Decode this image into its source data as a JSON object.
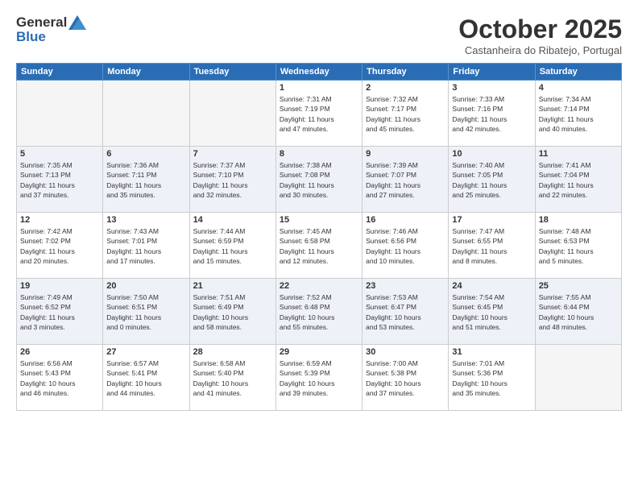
{
  "header": {
    "logo_general": "General",
    "logo_blue": "Blue",
    "month": "October 2025",
    "location": "Castanheira do Ribatejo, Portugal"
  },
  "weekdays": [
    "Sunday",
    "Monday",
    "Tuesday",
    "Wednesday",
    "Thursday",
    "Friday",
    "Saturday"
  ],
  "weeks": [
    [
      {
        "day": "",
        "info": ""
      },
      {
        "day": "",
        "info": ""
      },
      {
        "day": "",
        "info": ""
      },
      {
        "day": "1",
        "info": "Sunrise: 7:31 AM\nSunset: 7:19 PM\nDaylight: 11 hours\nand 47 minutes."
      },
      {
        "day": "2",
        "info": "Sunrise: 7:32 AM\nSunset: 7:17 PM\nDaylight: 11 hours\nand 45 minutes."
      },
      {
        "day": "3",
        "info": "Sunrise: 7:33 AM\nSunset: 7:16 PM\nDaylight: 11 hours\nand 42 minutes."
      },
      {
        "day": "4",
        "info": "Sunrise: 7:34 AM\nSunset: 7:14 PM\nDaylight: 11 hours\nand 40 minutes."
      }
    ],
    [
      {
        "day": "5",
        "info": "Sunrise: 7:35 AM\nSunset: 7:13 PM\nDaylight: 11 hours\nand 37 minutes."
      },
      {
        "day": "6",
        "info": "Sunrise: 7:36 AM\nSunset: 7:11 PM\nDaylight: 11 hours\nand 35 minutes."
      },
      {
        "day": "7",
        "info": "Sunrise: 7:37 AM\nSunset: 7:10 PM\nDaylight: 11 hours\nand 32 minutes."
      },
      {
        "day": "8",
        "info": "Sunrise: 7:38 AM\nSunset: 7:08 PM\nDaylight: 11 hours\nand 30 minutes."
      },
      {
        "day": "9",
        "info": "Sunrise: 7:39 AM\nSunset: 7:07 PM\nDaylight: 11 hours\nand 27 minutes."
      },
      {
        "day": "10",
        "info": "Sunrise: 7:40 AM\nSunset: 7:05 PM\nDaylight: 11 hours\nand 25 minutes."
      },
      {
        "day": "11",
        "info": "Sunrise: 7:41 AM\nSunset: 7:04 PM\nDaylight: 11 hours\nand 22 minutes."
      }
    ],
    [
      {
        "day": "12",
        "info": "Sunrise: 7:42 AM\nSunset: 7:02 PM\nDaylight: 11 hours\nand 20 minutes."
      },
      {
        "day": "13",
        "info": "Sunrise: 7:43 AM\nSunset: 7:01 PM\nDaylight: 11 hours\nand 17 minutes."
      },
      {
        "day": "14",
        "info": "Sunrise: 7:44 AM\nSunset: 6:59 PM\nDaylight: 11 hours\nand 15 minutes."
      },
      {
        "day": "15",
        "info": "Sunrise: 7:45 AM\nSunset: 6:58 PM\nDaylight: 11 hours\nand 12 minutes."
      },
      {
        "day": "16",
        "info": "Sunrise: 7:46 AM\nSunset: 6:56 PM\nDaylight: 11 hours\nand 10 minutes."
      },
      {
        "day": "17",
        "info": "Sunrise: 7:47 AM\nSunset: 6:55 PM\nDaylight: 11 hours\nand 8 minutes."
      },
      {
        "day": "18",
        "info": "Sunrise: 7:48 AM\nSunset: 6:53 PM\nDaylight: 11 hours\nand 5 minutes."
      }
    ],
    [
      {
        "day": "19",
        "info": "Sunrise: 7:49 AM\nSunset: 6:52 PM\nDaylight: 11 hours\nand 3 minutes."
      },
      {
        "day": "20",
        "info": "Sunrise: 7:50 AM\nSunset: 6:51 PM\nDaylight: 11 hours\nand 0 minutes."
      },
      {
        "day": "21",
        "info": "Sunrise: 7:51 AM\nSunset: 6:49 PM\nDaylight: 10 hours\nand 58 minutes."
      },
      {
        "day": "22",
        "info": "Sunrise: 7:52 AM\nSunset: 6:48 PM\nDaylight: 10 hours\nand 55 minutes."
      },
      {
        "day": "23",
        "info": "Sunrise: 7:53 AM\nSunset: 6:47 PM\nDaylight: 10 hours\nand 53 minutes."
      },
      {
        "day": "24",
        "info": "Sunrise: 7:54 AM\nSunset: 6:45 PM\nDaylight: 10 hours\nand 51 minutes."
      },
      {
        "day": "25",
        "info": "Sunrise: 7:55 AM\nSunset: 6:44 PM\nDaylight: 10 hours\nand 48 minutes."
      }
    ],
    [
      {
        "day": "26",
        "info": "Sunrise: 6:56 AM\nSunset: 5:43 PM\nDaylight: 10 hours\nand 46 minutes."
      },
      {
        "day": "27",
        "info": "Sunrise: 6:57 AM\nSunset: 5:41 PM\nDaylight: 10 hours\nand 44 minutes."
      },
      {
        "day": "28",
        "info": "Sunrise: 6:58 AM\nSunset: 5:40 PM\nDaylight: 10 hours\nand 41 minutes."
      },
      {
        "day": "29",
        "info": "Sunrise: 6:59 AM\nSunset: 5:39 PM\nDaylight: 10 hours\nand 39 minutes."
      },
      {
        "day": "30",
        "info": "Sunrise: 7:00 AM\nSunset: 5:38 PM\nDaylight: 10 hours\nand 37 minutes."
      },
      {
        "day": "31",
        "info": "Sunrise: 7:01 AM\nSunset: 5:36 PM\nDaylight: 10 hours\nand 35 minutes."
      },
      {
        "day": "",
        "info": ""
      }
    ]
  ]
}
